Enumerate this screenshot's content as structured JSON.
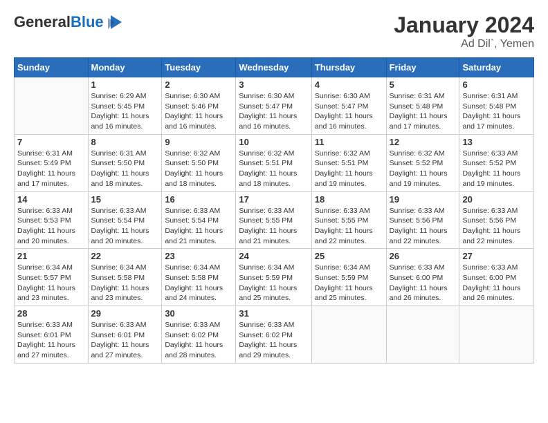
{
  "header": {
    "logo_general": "General",
    "logo_blue": "Blue",
    "month": "January 2024",
    "location": "Ad Dil`, Yemen"
  },
  "days_of_week": [
    "Sunday",
    "Monday",
    "Tuesday",
    "Wednesday",
    "Thursday",
    "Friday",
    "Saturday"
  ],
  "weeks": [
    [
      {
        "day": "",
        "info": ""
      },
      {
        "day": "1",
        "info": "Sunrise: 6:29 AM\nSunset: 5:45 PM\nDaylight: 11 hours\nand 16 minutes."
      },
      {
        "day": "2",
        "info": "Sunrise: 6:30 AM\nSunset: 5:46 PM\nDaylight: 11 hours\nand 16 minutes."
      },
      {
        "day": "3",
        "info": "Sunrise: 6:30 AM\nSunset: 5:47 PM\nDaylight: 11 hours\nand 16 minutes."
      },
      {
        "day": "4",
        "info": "Sunrise: 6:30 AM\nSunset: 5:47 PM\nDaylight: 11 hours\nand 16 minutes."
      },
      {
        "day": "5",
        "info": "Sunrise: 6:31 AM\nSunset: 5:48 PM\nDaylight: 11 hours\nand 17 minutes."
      },
      {
        "day": "6",
        "info": "Sunrise: 6:31 AM\nSunset: 5:48 PM\nDaylight: 11 hours\nand 17 minutes."
      }
    ],
    [
      {
        "day": "7",
        "info": "Sunrise: 6:31 AM\nSunset: 5:49 PM\nDaylight: 11 hours\nand 17 minutes."
      },
      {
        "day": "8",
        "info": "Sunrise: 6:31 AM\nSunset: 5:50 PM\nDaylight: 11 hours\nand 18 minutes."
      },
      {
        "day": "9",
        "info": "Sunrise: 6:32 AM\nSunset: 5:50 PM\nDaylight: 11 hours\nand 18 minutes."
      },
      {
        "day": "10",
        "info": "Sunrise: 6:32 AM\nSunset: 5:51 PM\nDaylight: 11 hours\nand 18 minutes."
      },
      {
        "day": "11",
        "info": "Sunrise: 6:32 AM\nSunset: 5:51 PM\nDaylight: 11 hours\nand 19 minutes."
      },
      {
        "day": "12",
        "info": "Sunrise: 6:32 AM\nSunset: 5:52 PM\nDaylight: 11 hours\nand 19 minutes."
      },
      {
        "day": "13",
        "info": "Sunrise: 6:33 AM\nSunset: 5:52 PM\nDaylight: 11 hours\nand 19 minutes."
      }
    ],
    [
      {
        "day": "14",
        "info": "Sunrise: 6:33 AM\nSunset: 5:53 PM\nDaylight: 11 hours\nand 20 minutes."
      },
      {
        "day": "15",
        "info": "Sunrise: 6:33 AM\nSunset: 5:54 PM\nDaylight: 11 hours\nand 20 minutes."
      },
      {
        "day": "16",
        "info": "Sunrise: 6:33 AM\nSunset: 5:54 PM\nDaylight: 11 hours\nand 21 minutes."
      },
      {
        "day": "17",
        "info": "Sunrise: 6:33 AM\nSunset: 5:55 PM\nDaylight: 11 hours\nand 21 minutes."
      },
      {
        "day": "18",
        "info": "Sunrise: 6:33 AM\nSunset: 5:55 PM\nDaylight: 11 hours\nand 22 minutes."
      },
      {
        "day": "19",
        "info": "Sunrise: 6:33 AM\nSunset: 5:56 PM\nDaylight: 11 hours\nand 22 minutes."
      },
      {
        "day": "20",
        "info": "Sunrise: 6:33 AM\nSunset: 5:56 PM\nDaylight: 11 hours\nand 22 minutes."
      }
    ],
    [
      {
        "day": "21",
        "info": "Sunrise: 6:34 AM\nSunset: 5:57 PM\nDaylight: 11 hours\nand 23 minutes."
      },
      {
        "day": "22",
        "info": "Sunrise: 6:34 AM\nSunset: 5:58 PM\nDaylight: 11 hours\nand 23 minutes."
      },
      {
        "day": "23",
        "info": "Sunrise: 6:34 AM\nSunset: 5:58 PM\nDaylight: 11 hours\nand 24 minutes."
      },
      {
        "day": "24",
        "info": "Sunrise: 6:34 AM\nSunset: 5:59 PM\nDaylight: 11 hours\nand 25 minutes."
      },
      {
        "day": "25",
        "info": "Sunrise: 6:34 AM\nSunset: 5:59 PM\nDaylight: 11 hours\nand 25 minutes."
      },
      {
        "day": "26",
        "info": "Sunrise: 6:33 AM\nSunset: 6:00 PM\nDaylight: 11 hours\nand 26 minutes."
      },
      {
        "day": "27",
        "info": "Sunrise: 6:33 AM\nSunset: 6:00 PM\nDaylight: 11 hours\nand 26 minutes."
      }
    ],
    [
      {
        "day": "28",
        "info": "Sunrise: 6:33 AM\nSunset: 6:01 PM\nDaylight: 11 hours\nand 27 minutes."
      },
      {
        "day": "29",
        "info": "Sunrise: 6:33 AM\nSunset: 6:01 PM\nDaylight: 11 hours\nand 27 minutes."
      },
      {
        "day": "30",
        "info": "Sunrise: 6:33 AM\nSunset: 6:02 PM\nDaylight: 11 hours\nand 28 minutes."
      },
      {
        "day": "31",
        "info": "Sunrise: 6:33 AM\nSunset: 6:02 PM\nDaylight: 11 hours\nand 29 minutes."
      },
      {
        "day": "",
        "info": ""
      },
      {
        "day": "",
        "info": ""
      },
      {
        "day": "",
        "info": ""
      }
    ]
  ]
}
